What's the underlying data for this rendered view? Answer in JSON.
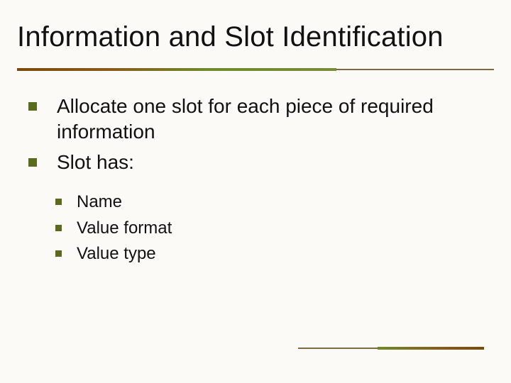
{
  "title": "Information and Slot Identification",
  "bullets": {
    "level1": [
      "Allocate one slot for each piece of required information",
      "Slot has:"
    ],
    "level2": [
      "Name",
      "Value format",
      "Value type"
    ]
  }
}
